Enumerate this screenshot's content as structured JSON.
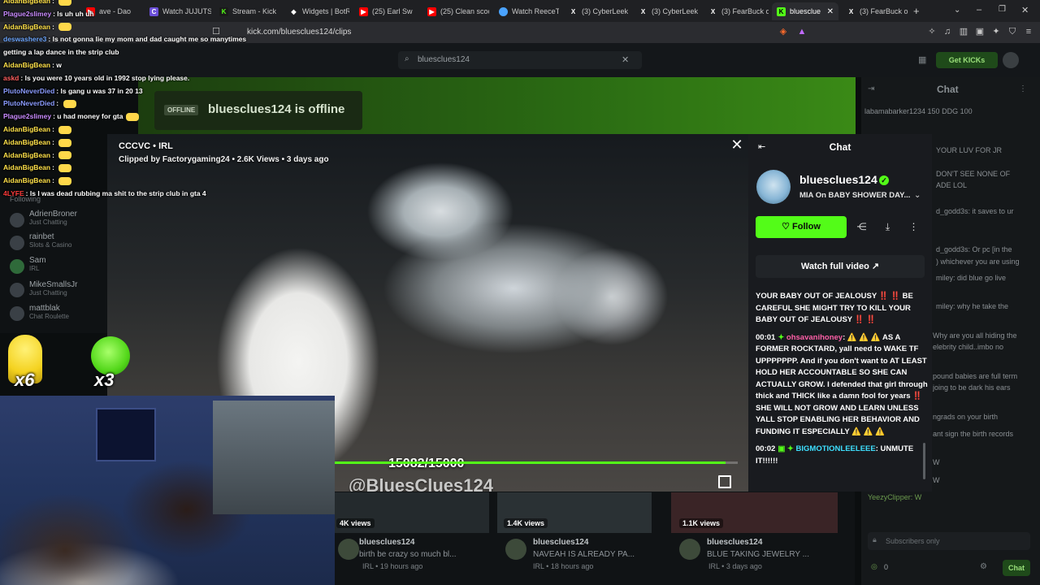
{
  "browser": {
    "tabs": [
      {
        "label": "ave - Dao",
        "icon": "youtube-icon",
        "color": "#ff0000"
      },
      {
        "label": "Watch JUJUTS",
        "icon": "crunchyroll-icon",
        "color": "#6b4fd8"
      },
      {
        "label": "Stream - Kick",
        "icon": "kick-icon",
        "color": "#53fc18"
      },
      {
        "label": "Widgets | BotR",
        "icon": "widgets-icon",
        "color": "#ffffff"
      },
      {
        "label": "(25) Earl Sw",
        "icon": "youtube-icon",
        "color": "#ff0000"
      },
      {
        "label": "(25) Clean scoo",
        "icon": "youtube-icon",
        "color": "#ff0000"
      },
      {
        "label": "Watch ReeceTo",
        "icon": "watch-icon",
        "color": "#4aa3ff"
      },
      {
        "label": "(3) CyberLeek",
        "icon": "x-icon",
        "color": "#ffffff"
      },
      {
        "label": "(3) CyberLeek",
        "icon": "x-icon",
        "color": "#ffffff"
      },
      {
        "label": "(3) FearBuck o",
        "icon": "x-icon",
        "color": "#ffffff"
      },
      {
        "label": "bluesclue",
        "icon": "kick-icon",
        "color": "#53fc18"
      },
      {
        "label": "(3) FearBuck o",
        "icon": "x-icon",
        "color": "#ffffff"
      }
    ],
    "url": "kick.com/bluesclues124/clips"
  },
  "kick": {
    "search_value": "bluesclues124",
    "get_kicks": "Get KICKs",
    "offline_badge": "OFFLINE",
    "offline_text": "bluesclues124 is offline",
    "chat_header": "Chat",
    "following_label": "Following",
    "sidebar": [
      {
        "name": "AdrienBroner",
        "sub": "Just Chatting"
      },
      {
        "name": "rainbet",
        "sub": "Slots & Casino"
      },
      {
        "name": "Sam",
        "sub": "IRL"
      },
      {
        "name": "MikeSmallsJr",
        "sub": "Just Chatting"
      },
      {
        "name": "mattblak",
        "sub": "Chat Roulette"
      }
    ],
    "bg_chat": [
      "labamabarker1234 150  DDG 100",
      "YOUR LUV FOR JR",
      "DON'T SEE NONE OF",
      "ADE LOL",
      "d_godd3s: it saves to ur",
      "d_godd3s: Or pc [in the",
      ") whichever you are using",
      "miley: did blue go live",
      "miley: why he take the",
      "Why are you all hiding the",
      "elebrity child..imbo no",
      "pound babies are full term",
      "joing to be dark his ears",
      "ngrads on your birth",
      "ant sign the birth records",
      "W",
      "W",
      "YeezyClipper: W"
    ],
    "subs_only": "Subscribers only",
    "viewer_count": "0",
    "chat_button": "Chat"
  },
  "overlay_chat": [
    {
      "user": "AidanBigBean",
      "color": "#ffe14a",
      "text": "",
      "emote": true
    },
    {
      "user": "Plague2slimey",
      "color": "#c98bff",
      "text": "ls uh uh uh",
      "emote": false
    },
    {
      "user": "AidanBigBean",
      "color": "#ffe14a",
      "text": "",
      "emote": true
    },
    {
      "user": "deswashere3",
      "color": "#6fa8ff",
      "text": "ls not gonna lie my mom and dad caught me so manytimes",
      "emote": false
    },
    {
      "user": "",
      "color": "#ffffff",
      "text": "getting a lap dance in the strip club",
      "emote": false
    },
    {
      "user": "AidanBigBean",
      "color": "#ffe14a",
      "text": "w",
      "emote": false
    },
    {
      "user": "askd",
      "color": "#ff5f5f",
      "text": "ls you were 10 years old in 1992 stop lying please.",
      "emote": false
    },
    {
      "user": "PlutoNeverDied",
      "color": "#8b9cff",
      "text": "ls gang u was 37 in 20 13",
      "emote": false
    },
    {
      "user": "PlutoNeverDied",
      "color": "#8b9cff",
      "text": "",
      "emote": true
    },
    {
      "user": "Plague2slimey",
      "color": "#c98bff",
      "text": "u had money for gta",
      "emote": true
    },
    {
      "user": "AidanBigBean",
      "color": "#ffe14a",
      "text": "",
      "emote": true
    },
    {
      "user": "AidanBigBean",
      "color": "#ffe14a",
      "text": "",
      "emote": true
    },
    {
      "user": "AidanBigBean",
      "color": "#ffe14a",
      "text": "",
      "emote": true
    },
    {
      "user": "AidanBigBean",
      "color": "#ffe14a",
      "text": "",
      "emote": true
    },
    {
      "user": "AidanBigBean",
      "color": "#ffe14a",
      "text": "",
      "emote": true
    },
    {
      "user": "4LYFE",
      "color": "#ff3b3b",
      "text": "ls I was dead rubbing ma shit to the strip club in gta 4",
      "emote": false
    }
  ],
  "emotes": {
    "left_count": "x6",
    "right_count": "x3"
  },
  "clip": {
    "title": "CCCVC • IRL",
    "meta": "Clipped by Factorygaming24 • 2.6K Views • 3 days ago",
    "counter": "15082/15000",
    "watermark": "@BluesClues124",
    "progress": 0.98
  },
  "clip_chat": {
    "header": "Chat",
    "channel": "bluesclues124",
    "status": "MIA On BABY SHOWER DAY...",
    "follow": "Follow",
    "watch_full": "Watch full video",
    "messages": [
      {
        "ts": "",
        "user": "",
        "user_class": "",
        "text": "YOUR BABY OUT OF JEALOUSY ‼️ ‼️ BE CAREFUL SHE MIGHT TRY TO KILL YOUR BABY OUT OF JEALOUSY ‼️ ‼️"
      },
      {
        "ts": "00:01",
        "user": "ohsavanihoney",
        "user_class": "u-pink",
        "text": "⚠️ ⚠️ ⚠️ AS A FORMER ROCKTARD, yall need to WAKE TF UPPPPPPP. And if you don't want to AT LEAST HOLD HER ACCOUNTABLE SO SHE CAN ACTUALLY GROW. I defended that girl through thick and THICK like a damn fool for years ‼️ SHE WILL NOT GROW AND LEARN UNLESS YALL STOP ENABLING HER BEHAVIOR AND FUNDING IT ESPECIALLY ⚠️ ⚠️ ⚠️"
      },
      {
        "ts": "00:02",
        "user": "BIGMOTIONLEELEEE",
        "user_class": "u-cyan",
        "text": "UNMUTE IT!!!!!!"
      }
    ]
  },
  "clip_cards": [
    {
      "views": "4K views",
      "name": "bluesclues124",
      "title": "birth be crazy so much bl...",
      "meta": "IRL • 19 hours ago"
    },
    {
      "views": "1.4K views",
      "name": "bluesclues124",
      "title": "NAVEAH IS ALREADY PA...",
      "meta": "IRL • 18 hours ago"
    },
    {
      "views": "1.1K views",
      "name": "bluesclues124",
      "title": "BLUE TAKING JEWELRY ...",
      "meta": "IRL • 3 days ago"
    }
  ]
}
